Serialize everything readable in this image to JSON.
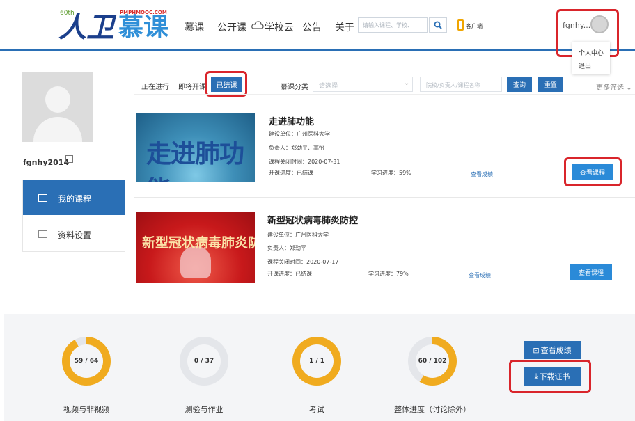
{
  "header": {
    "logo_main_a": "人卫",
    "logo_main_b": "慕课",
    "logo_en": "PMPHMOOC.COM",
    "logo_badge": "60th",
    "nav": [
      "慕课",
      "公开课",
      "学校云",
      "公告",
      "关于"
    ],
    "search_placeholder": "请输入课程、学校、",
    "client_label": "客户端",
    "user_name": "fgnhy...",
    "dropdown": [
      "个人中心",
      "退出"
    ]
  },
  "sidebar": {
    "profile_name": "fgnhy2014",
    "menu": [
      {
        "label": "我的课程",
        "active": true
      },
      {
        "label": "资料设置",
        "active": false
      }
    ]
  },
  "filters": {
    "tabs": [
      "正在进行",
      "即将开课",
      "已结课"
    ],
    "active_tab": "已结课",
    "category_label": "慕课分类",
    "category_placeholder": "请选择",
    "school_placeholder": "院校/负责人/课程名称",
    "query_label": "查询",
    "reset_label": "重置",
    "more_label": "更多筛选"
  },
  "courses": [
    {
      "thumb_text": "走进肺功能",
      "title": "走进肺功能",
      "unit": "建设单位：广州医科大学",
      "leader": "负责人：郑劲平、高怡",
      "closing": "课程关闭时间：2020-07-31",
      "status": "开课进度：已结课",
      "progress": "学习进度：59%",
      "grades_link": "查看成绩",
      "view_label": "查看课程"
    },
    {
      "thumb_text": "新型冠状病毒肺炎防控",
      "title": "新型冠状病毒肺炎防控",
      "unit": "建设单位：广州医科大学",
      "leader": "负责人：郑劲平",
      "closing": "课程关闭时间：2020-07-17",
      "status": "开课进度：已结课",
      "progress": "学习进度：79%",
      "grades_link": "查看成绩",
      "view_label": "查看课程"
    }
  ],
  "stats": [
    {
      "label": "视频与非视频",
      "text": "59 / 64",
      "done": 59,
      "total": 64
    },
    {
      "label": "测验与作业",
      "text": "0 / 37",
      "done": 0,
      "total": 37
    },
    {
      "label": "考试",
      "text": "1 / 1",
      "done": 1,
      "total": 1
    },
    {
      "label": "整体进度（讨论除外）",
      "text": "60 / 102",
      "done": 60,
      "total": 102
    }
  ],
  "stat_buttons": {
    "grades_label": "查看成绩",
    "download_label": "下载证书"
  },
  "colors": {
    "accent": "#2a6fb5",
    "highlight_ring": "#d9252b",
    "donut_fill": "#f0ab1f",
    "donut_track": "#e4e6ea"
  }
}
